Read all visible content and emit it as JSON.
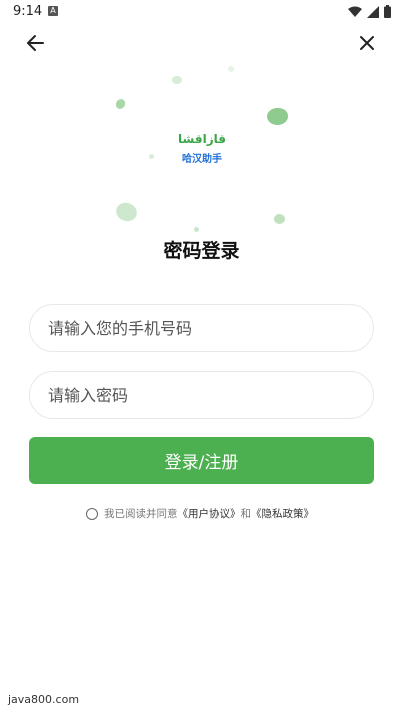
{
  "status_bar": {
    "time": "9:14",
    "notification_icon": "a-icon",
    "icons": [
      "wifi-icon",
      "signal-icon",
      "battery-icon"
    ]
  },
  "nav": {
    "back_icon": "arrow-left-icon",
    "close_icon": "close-icon"
  },
  "logo": {
    "top_text": "قازاقشا",
    "bottom_text": "哈汉助手"
  },
  "title": "密码登录",
  "phone_input": {
    "placeholder": "请输入您的手机号码",
    "value": ""
  },
  "password_input": {
    "placeholder": "请输入密码",
    "value": ""
  },
  "login_button": {
    "label": "登录/注册"
  },
  "agreement": {
    "prefix": "我已阅读并同意",
    "user_agreement": "《用户协议》",
    "and": "和",
    "privacy_policy": "《隐私政策》",
    "checked": false
  },
  "watermark": "java800.com",
  "colors": {
    "accent": "#4caf50",
    "logo_green": "#3aa648",
    "logo_blue": "#1f6fd6"
  }
}
